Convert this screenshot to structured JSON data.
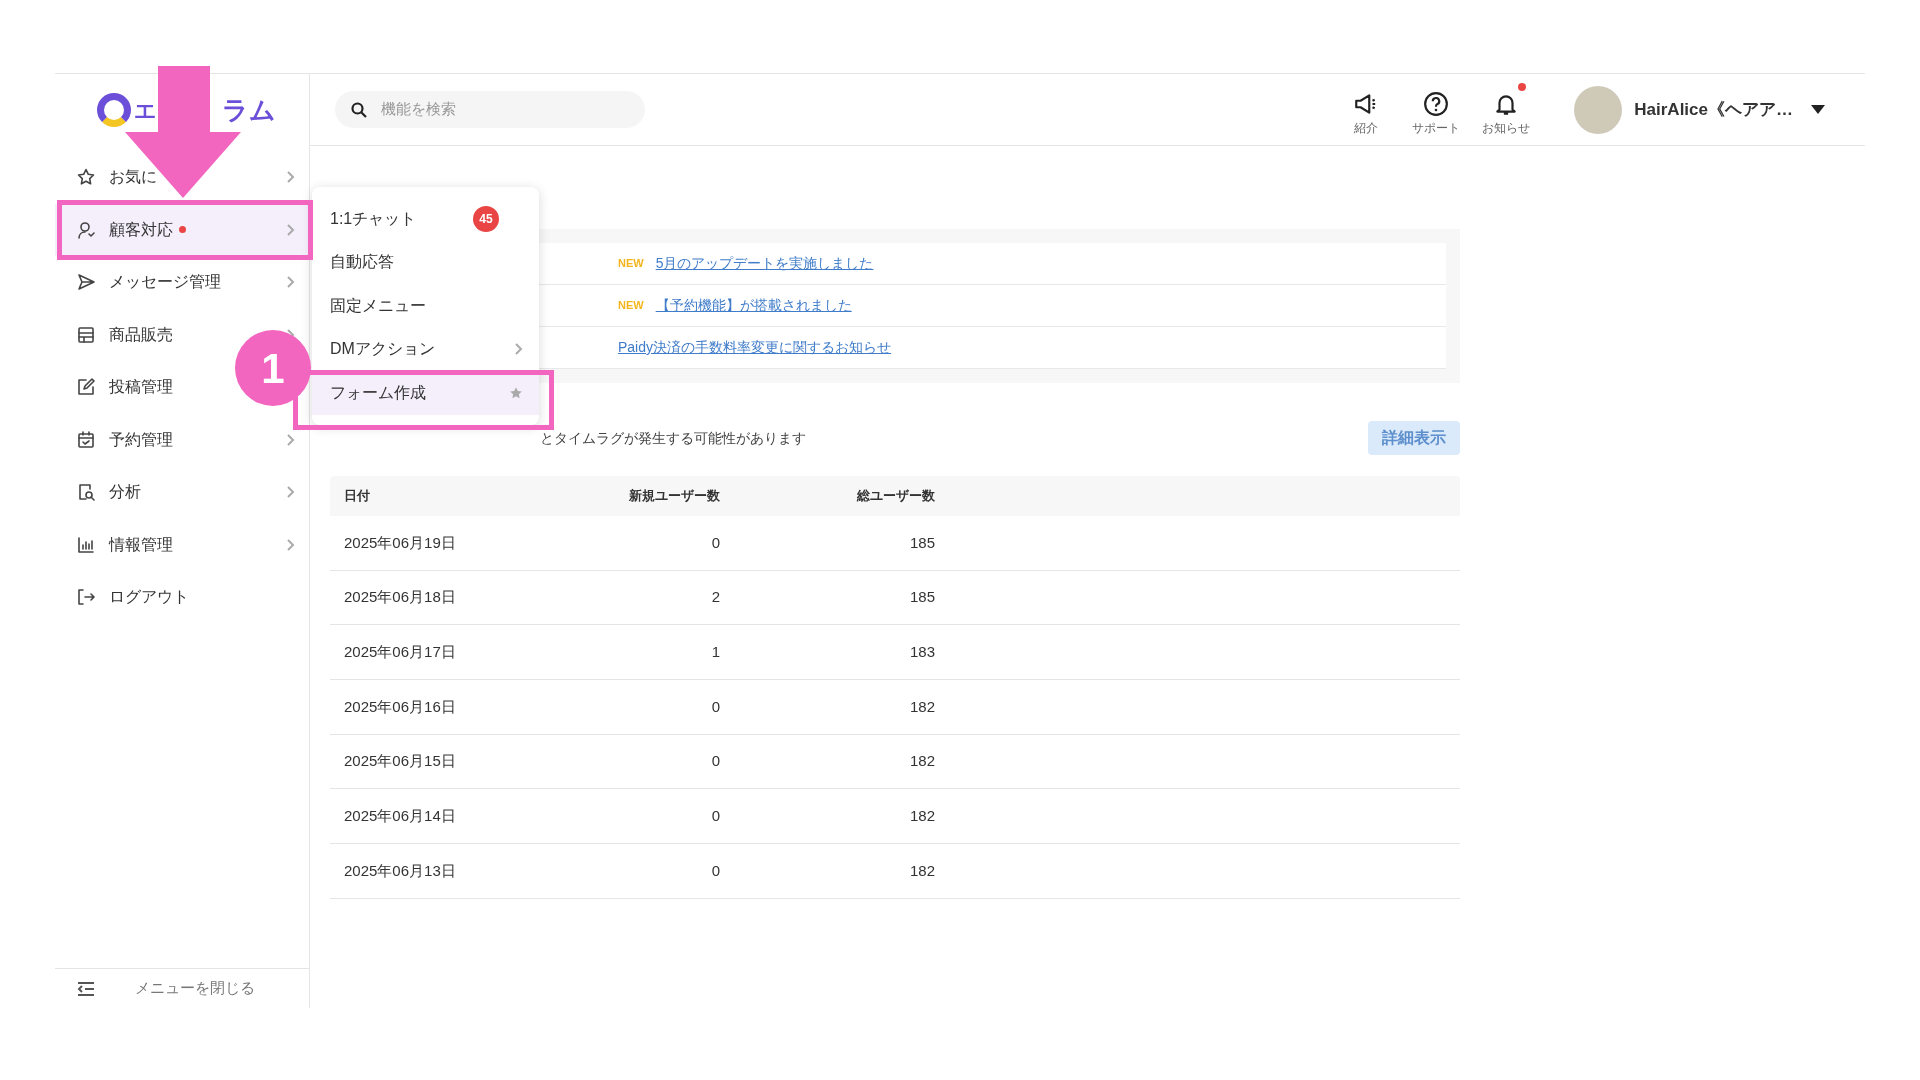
{
  "logo": {
    "parts": [
      "エ",
      "ラム"
    ]
  },
  "search": {
    "placeholder": "機能を検索"
  },
  "header_actions": [
    {
      "kind": "megaphone",
      "label": "紹介",
      "dot": false
    },
    {
      "kind": "help",
      "label": "サポート",
      "dot": false
    },
    {
      "kind": "bell",
      "label": "お知らせ",
      "dot": true
    }
  ],
  "account": {
    "name": "HairAlice《ヘアア…"
  },
  "sidebar": {
    "items": [
      {
        "kind": "star",
        "label": "お気に",
        "selected": false,
        "dot": false,
        "chevron": true
      },
      {
        "kind": "person",
        "label": "顧客対応",
        "selected": true,
        "dot": true,
        "chevron": true
      },
      {
        "kind": "send",
        "label": "メッセージ管理",
        "selected": false,
        "dot": false,
        "chevron": true
      },
      {
        "kind": "store",
        "label": "商品販売",
        "selected": false,
        "dot": false,
        "chevron": true
      },
      {
        "kind": "edit",
        "label": "投稿管理",
        "selected": false,
        "dot": false,
        "chevron": false
      },
      {
        "kind": "calendar",
        "label": "予約管理",
        "selected": false,
        "dot": false,
        "chevron": true
      },
      {
        "kind": "report",
        "label": "分析",
        "selected": false,
        "dot": false,
        "chevron": true
      },
      {
        "kind": "chart",
        "label": "情報管理",
        "selected": false,
        "dot": false,
        "chevron": true
      },
      {
        "kind": "logout",
        "label": "ログアウト",
        "selected": false,
        "dot": false,
        "chevron": false
      }
    ],
    "close_menu": "メニューを閉じる"
  },
  "submenu": [
    {
      "label": "1:1チャット",
      "badge": "45",
      "chevron": false,
      "star": false,
      "selected": false
    },
    {
      "label": "自動応答",
      "chevron": false,
      "star": false,
      "selected": false
    },
    {
      "label": "固定メニュー",
      "chevron": false,
      "star": false,
      "selected": false
    },
    {
      "label": "DMアクション",
      "chevron": true,
      "star": false,
      "selected": false
    },
    {
      "label": "フォーム作成",
      "chevron": false,
      "star": true,
      "selected": true
    }
  ],
  "notices": [
    {
      "new": true,
      "tag": "NEW",
      "title": "5月のアップデートを実施しました"
    },
    {
      "new": true,
      "tag": "NEW",
      "title": "【予約機能】が搭載されました"
    },
    {
      "new": false,
      "title": "Paidy決済の手数料率変更に関するお知らせ"
    }
  ],
  "stats": {
    "note": "とタイムラグが発生する可能性があります",
    "detail_button": "詳細表示",
    "columns": [
      "日付",
      "新規ユーザー数",
      "総ユーザー数"
    ],
    "rows": [
      [
        "2025年06月19日",
        "0",
        "185"
      ],
      [
        "2025年06月18日",
        "2",
        "185"
      ],
      [
        "2025年06月17日",
        "1",
        "183"
      ],
      [
        "2025年06月16日",
        "0",
        "182"
      ],
      [
        "2025年06月15日",
        "0",
        "182"
      ],
      [
        "2025年06月14日",
        "0",
        "182"
      ],
      [
        "2025年06月13日",
        "0",
        "182"
      ]
    ]
  },
  "annotation": {
    "step": "1"
  }
}
